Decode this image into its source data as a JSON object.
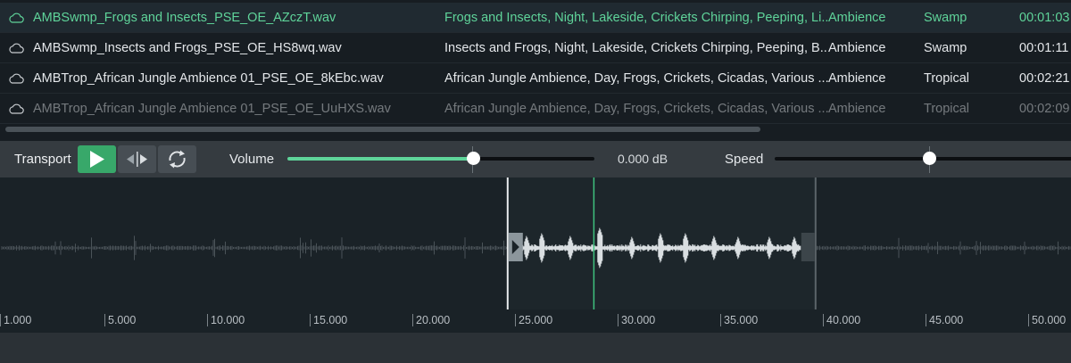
{
  "file_list": {
    "rows": [
      {
        "filename": "AMBSwmp_Frogs and Insects_PSE_OE_AZczT.wav",
        "description": "Frogs and Insects, Night, Lakeside, Crickets Chirping, Peeping, Li...",
        "category": "Ambience",
        "subcategory": "Swamp",
        "duration": "00:01:03",
        "selected": true
      },
      {
        "filename": "AMBSwmp_Insects and Frogs_PSE_OE_HS8wq.wav",
        "description": "Insects and Frogs, Night, Lakeside, Crickets Chirping, Peeping, B...",
        "category": "Ambience",
        "subcategory": "Swamp",
        "duration": "00:01:11",
        "selected": false
      },
      {
        "filename": "AMBTrop_African Jungle Ambience 01_PSE_OE_8kEbc.wav",
        "description": "African Jungle Ambience, Day, Frogs, Crickets, Cicadas, Various ...",
        "category": "Ambience",
        "subcategory": "Tropical",
        "duration": "00:02:21",
        "selected": false
      },
      {
        "filename": "AMBTrop_African Jungle Ambience 01_PSE_OE_UuHXS.wav",
        "description": "African Jungle Ambience, Day, Frogs, Crickets, Cicadas, Various ...",
        "category": "Ambience",
        "subcategory": "Tropical",
        "duration": "00:02:09",
        "selected": false
      }
    ],
    "row_icon": "cloud-icon"
  },
  "transport": {
    "label": "Transport",
    "play_icon": "play-icon",
    "trim_icon": "trim-to-selection-icon",
    "loop_icon": "loop-icon",
    "volume_label": "Volume",
    "volume_value": "0.000 dB",
    "volume_level": 0.605,
    "speed_label": "Speed",
    "speed_level": 0.5
  },
  "waveform": {
    "timeline_ticks": [
      "1.000",
      "5.000",
      "10.000",
      "15.000",
      "20.000",
      "25.000",
      "30.000",
      "35.000",
      "40.000",
      "45.000",
      "50.000"
    ],
    "selection_start": 24.6,
    "selection_end": 39.6,
    "playhead": 28.8
  },
  "colors": {
    "accent": "#5fd49a",
    "play_button": "#38a86a",
    "list_background": "#171d22",
    "waveform_background": "#1a2227"
  }
}
